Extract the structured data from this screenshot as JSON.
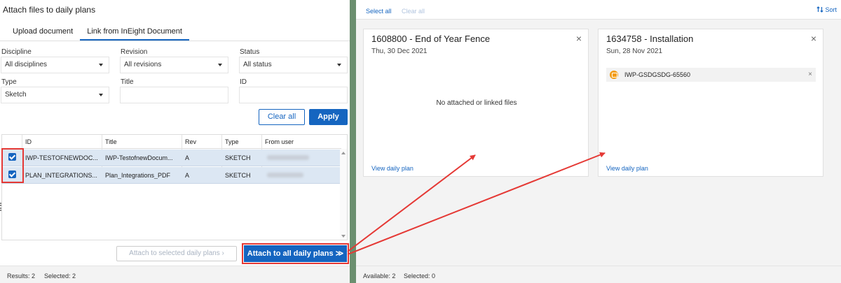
{
  "left": {
    "title": "Attach files to daily plans",
    "tabs": [
      {
        "label": "Upload document"
      },
      {
        "label": "Link from InEight Document"
      }
    ],
    "filters": {
      "discipline": {
        "label": "Discipline",
        "value": "All disciplines"
      },
      "revision": {
        "label": "Revision",
        "value": "All revisions"
      },
      "status": {
        "label": "Status",
        "value": "All status"
      },
      "type": {
        "label": "Type",
        "value": "Sketch"
      },
      "title": {
        "label": "Title",
        "value": ""
      },
      "id": {
        "label": "ID",
        "value": ""
      }
    },
    "clear_all": "Clear all",
    "apply": "Apply",
    "grid": {
      "columns": [
        "ID",
        "Title",
        "Rev",
        "Type",
        "From user"
      ],
      "rows": [
        {
          "checked": true,
          "id": "IWP-TESTOFNEWDOC...",
          "title": "IWP-TestofnewDocum...",
          "rev": "A",
          "type": "SKETCH"
        },
        {
          "checked": true,
          "id": "PLAN_INTEGRATIONS...",
          "title": "Plan_Integrations_PDF",
          "rev": "A",
          "type": "SKETCH"
        }
      ]
    },
    "attach_selected": "Attach to selected daily plans ›",
    "attach_all": "Attach to all daily plans ≫",
    "status": {
      "results": "Results: 2",
      "selected": "Selected: 2"
    }
  },
  "right": {
    "select_all": "Select all",
    "clear_all": "Clear all",
    "sort": "Sort",
    "sort_icon": "sort-arrows-icon",
    "cards": [
      {
        "title": "1608800 - End of Year Fence",
        "date": "Thu, 30 Dec 2021",
        "empty": "No attached or linked files",
        "view": "View daily plan"
      },
      {
        "title": "1634758 - Installation",
        "date": "Sun, 28 Nov 2021",
        "file": "IWP-GSDGSDG-65560",
        "view": "View daily plan"
      }
    ],
    "status": {
      "available": "Available: 2",
      "selected": "Selected: 0"
    }
  },
  "colors": {
    "accent": "#1565c0",
    "highlight": "#e53935",
    "divider": "#6b8f6f"
  }
}
